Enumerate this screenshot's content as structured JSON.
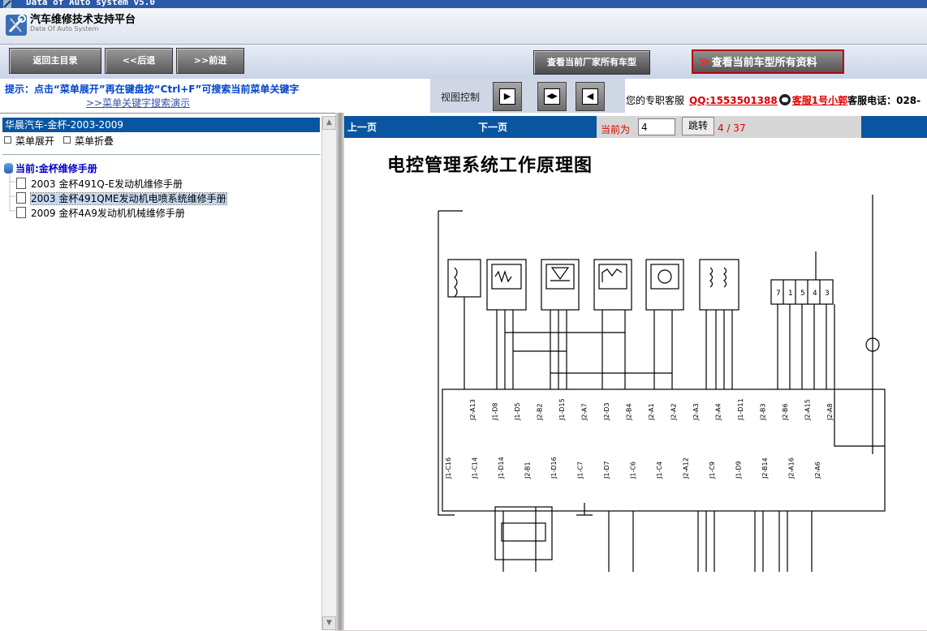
{
  "window": {
    "title": "Data of Auto system v5.0"
  },
  "header": {
    "title": "汽车维修技术支持平台",
    "subtitle": "Data Of Auto System"
  },
  "toolbar": {
    "home_label": "返回主目录",
    "back_label": "<<后退",
    "forward_label": ">>前进",
    "factory_models_label": "查看当前厂家所有车型",
    "all_info_label": "查看当前车型所有资料"
  },
  "hint": {
    "text": "提示：点击“菜单展开”再在键盘按“Ctrl+F”可搜索当前菜单关键字",
    "link": ">>菜单关键字搜索演示"
  },
  "view_control": {
    "label": "视图控制",
    "buttons": [
      "expand-right",
      "split-view",
      "expand-left"
    ]
  },
  "service": {
    "label": "您的专职客服",
    "qq": "QQ:1553501388",
    "agent": "客服1号小郭",
    "phone_label": "客服电话：",
    "phone_partial": "028-"
  },
  "sidebar": {
    "vehicle": "华晨汽车-金杯-2003-2009",
    "expand_label": "菜单展开",
    "collapse_label": "菜单折叠",
    "current_label": "当前:金杯维修手册",
    "items": [
      {
        "label": "2003 金杯491Q-E发动机维修手册",
        "selected": false
      },
      {
        "label": "2003 金杯491QME发动机电喷系统维修手册",
        "selected": true
      },
      {
        "label": "2009 金杯4A9发动机机械维修手册",
        "selected": false
      }
    ]
  },
  "pager": {
    "prev_label": "上一页",
    "next_label": "下一页",
    "current_label": "当前为",
    "page_value": "4",
    "go_label": "跳转",
    "position": "4 / 37"
  },
  "document": {
    "title": "电控管理系统工作原理图",
    "pins_top": [
      "J2-A13",
      "J1-D8",
      "J1-D5",
      "J2-B2",
      "J1-D15",
      "J2-A7",
      "J2-D3",
      "J2-B4",
      "J2-A1",
      "J2-A2",
      "J2-A3",
      "J2-A4",
      "J1-D11",
      "J2-B3",
      "J2-B6",
      "J2-A15",
      "J2-A8"
    ],
    "pins_bottom": [
      "J1-C16",
      "J1-C14",
      "J1-D14",
      "J2-B1",
      "J1-D16",
      "J1-C7",
      "J1-D7",
      "J1-C6",
      "J1-C4",
      "J2-A12",
      "J1-C9",
      "J1-D9",
      "J2-B14",
      "J2-A16",
      "J2-A6"
    ],
    "connector_pins": [
      "7",
      "1",
      "5",
      "4",
      "3"
    ]
  },
  "colors": {
    "title_bar": "#2a5aa8",
    "accent_blue": "#0a55a0",
    "link_red": "#dd0000",
    "hint_blue": "#0044cc"
  }
}
